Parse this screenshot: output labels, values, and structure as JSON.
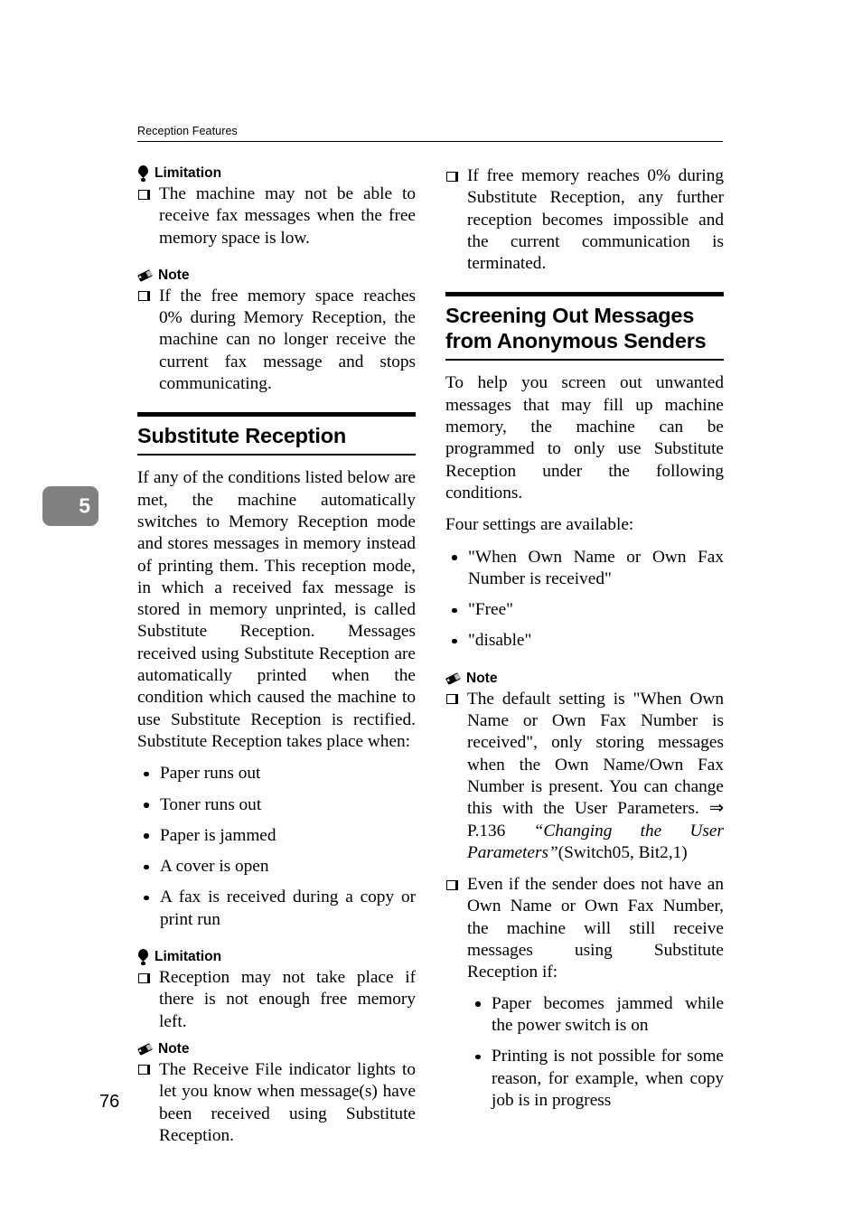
{
  "page": {
    "running_head": "Reception Features",
    "folio": "76",
    "chapter_tab": "5"
  },
  "icons": {
    "limitation": "limitation-bulb-icon",
    "note": "note-pencil-icon",
    "square_bullet": "square-bullet-icon",
    "round_bullet": "round-bullet-icon"
  },
  "left_column": {
    "limitation_1": {
      "label": "Limitation",
      "items": [
        "The machine may not be able to receive fax messages when the free memory space is low."
      ]
    },
    "note_1": {
      "label": "Note",
      "items": [
        "If the free memory space reaches 0% during Memory Reception, the machine can no longer receive the current fax message and stops communicating."
      ]
    },
    "section": {
      "title": "Substitute Reception",
      "intro": "If any of the conditions listed below are met, the machine automatically switches to Memory Reception mode and stores messages in memory instead of printing them. This reception mode, in which a received fax message is stored in memory unprinted, is called Substitute Reception. Messages received using Substitute Reception are automatically printed when the condition which caused the machine to use Substitute Reception is rectified. Substitute Reception takes place when:",
      "conditions": [
        "Paper runs out",
        "Toner runs out",
        "Paper is jammed",
        "A cover is open",
        "A fax is received during a copy or print run"
      ]
    },
    "limitation_2": {
      "label": "Limitation",
      "items": [
        "Reception may not take place if there is not enough free memory left."
      ]
    },
    "note_2": {
      "label": "Note",
      "items": [
        "The Receive File indicator lights to let you know when message(s) have been received using Substitute Reception."
      ]
    }
  },
  "right_column": {
    "continued_note": {
      "items": [
        "If free memory reaches 0% during Substitute Reception, any further reception becomes impossible and the current communication is terminated."
      ]
    },
    "section": {
      "title": "Screening Out Messages from Anonymous Senders",
      "intro": "To help you screen out unwanted messages that may fill up machine memory, the machine can be programmed to only use Substitute Reception under the following conditions.",
      "settings_lead": "Four settings are available:",
      "settings": [
        "\"When Own Name or Own Fax Number is received\"",
        "\"Free\"",
        "\"disable\""
      ]
    },
    "note": {
      "label": "Note",
      "item_1_part1": "The default setting is \"When Own Name or Own Fax Number is received\", only storing messages when the Own Name/Own Fax Number is present. You can change this with the User Parameters. ⇒ P.136 ",
      "item_1_ref": "“Changing the User Parameters”",
      "item_1_part2": "(Switch05, Bit2,1)",
      "item_2_lead": "Even if the sender does not have an Own Name or Own Fax Number, the machine will still receive messages using Substitute Reception if:",
      "item_2_bullets": [
        "Paper becomes jammed while the power switch is on",
        "Printing is not possible for some reason, for example, when copy job is in progress"
      ]
    }
  }
}
